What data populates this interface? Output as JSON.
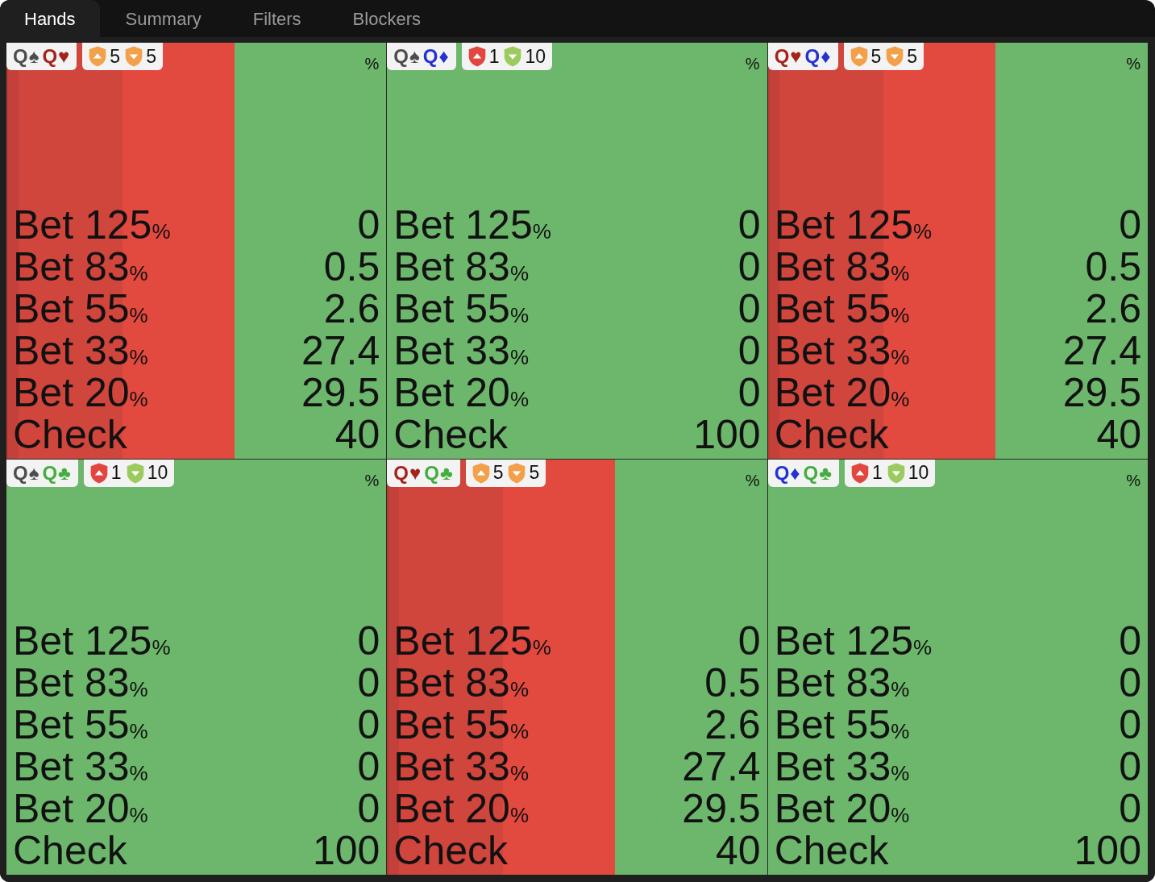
{
  "tabs": [
    {
      "label": "Hands",
      "selected": true
    },
    {
      "label": "Summary",
      "selected": false
    },
    {
      "label": "Filters",
      "selected": false
    },
    {
      "label": "Blockers",
      "selected": false
    }
  ],
  "cells": [
    {
      "hand": [
        {
          "label": "Q♠",
          "color": "#4d4d4d"
        },
        {
          "label": "Q♥",
          "color": "#a3241b"
        }
      ],
      "blockers": [
        {
          "kind": "up",
          "count": "5",
          "color": "#f2a04a"
        },
        {
          "kind": "down",
          "count": "5",
          "color": "#f2a04a"
        }
      ],
      "unit": "%",
      "actions": [
        {
          "label": "Bet 125",
          "unit": "%",
          "value": "0"
        },
        {
          "label": "Bet 83",
          "unit": "%",
          "value": "0.5",
          "color": "#b83b34"
        },
        {
          "label": "Bet 55",
          "unit": "%",
          "value": "2.6",
          "color": "#c4403a"
        },
        {
          "label": "Bet 33",
          "unit": "%",
          "value": "27.4",
          "color": "#d0453c"
        },
        {
          "label": "Bet 20",
          "unit": "%",
          "value": "29.5",
          "color": "#e2493f"
        },
        {
          "label": "Check",
          "value": "40",
          "color": "#6cb76b"
        }
      ]
    },
    {
      "hand": [
        {
          "label": "Q♠",
          "color": "#4d4d4d"
        },
        {
          "label": "Q♦",
          "color": "#2632d0"
        }
      ],
      "blockers": [
        {
          "kind": "up",
          "count": "1",
          "color": "#e2463f"
        },
        {
          "kind": "down",
          "count": "10",
          "color": "#9bcb5e"
        }
      ],
      "unit": "%",
      "actions": [
        {
          "label": "Bet 125",
          "unit": "%",
          "value": "0"
        },
        {
          "label": "Bet 83",
          "unit": "%",
          "value": "0"
        },
        {
          "label": "Bet 55",
          "unit": "%",
          "value": "0"
        },
        {
          "label": "Bet 33",
          "unit": "%",
          "value": "0"
        },
        {
          "label": "Bet 20",
          "unit": "%",
          "value": "0"
        },
        {
          "label": "Check",
          "value": "100",
          "color": "#6cb76b"
        }
      ]
    },
    {
      "hand": [
        {
          "label": "Q♥",
          "color": "#a3241b"
        },
        {
          "label": "Q♦",
          "color": "#2632d0"
        }
      ],
      "blockers": [
        {
          "kind": "up",
          "count": "5",
          "color": "#f2a04a"
        },
        {
          "kind": "down",
          "count": "5",
          "color": "#f2a04a"
        }
      ],
      "unit": "%",
      "actions": [
        {
          "label": "Bet 125",
          "unit": "%",
          "value": "0"
        },
        {
          "label": "Bet 83",
          "unit": "%",
          "value": "0.5",
          "color": "#b83b34"
        },
        {
          "label": "Bet 55",
          "unit": "%",
          "value": "2.6",
          "color": "#c4403a"
        },
        {
          "label": "Bet 33",
          "unit": "%",
          "value": "27.4",
          "color": "#d0453c"
        },
        {
          "label": "Bet 20",
          "unit": "%",
          "value": "29.5",
          "color": "#e2493f"
        },
        {
          "label": "Check",
          "value": "40",
          "color": "#6cb76b"
        }
      ]
    },
    {
      "hand": [
        {
          "label": "Q♠",
          "color": "#4d4d4d"
        },
        {
          "label": "Q♣",
          "color": "#43ad3f"
        }
      ],
      "blockers": [
        {
          "kind": "up",
          "count": "1",
          "color": "#e2463f"
        },
        {
          "kind": "down",
          "count": "10",
          "color": "#9bcb5e"
        }
      ],
      "unit": "%",
      "actions": [
        {
          "label": "Bet 125",
          "unit": "%",
          "value": "0"
        },
        {
          "label": "Bet 83",
          "unit": "%",
          "value": "0"
        },
        {
          "label": "Bet 55",
          "unit": "%",
          "value": "0"
        },
        {
          "label": "Bet 33",
          "unit": "%",
          "value": "0"
        },
        {
          "label": "Bet 20",
          "unit": "%",
          "value": "0"
        },
        {
          "label": "Check",
          "value": "100",
          "color": "#6cb76b"
        }
      ]
    },
    {
      "hand": [
        {
          "label": "Q♥",
          "color": "#a3241b"
        },
        {
          "label": "Q♣",
          "color": "#43ad3f"
        }
      ],
      "blockers": [
        {
          "kind": "up",
          "count": "5",
          "color": "#f2a04a"
        },
        {
          "kind": "down",
          "count": "5",
          "color": "#f2a04a"
        }
      ],
      "unit": "%",
      "actions": [
        {
          "label": "Bet 125",
          "unit": "%",
          "value": "0"
        },
        {
          "label": "Bet 83",
          "unit": "%",
          "value": "0.5",
          "color": "#b83b34"
        },
        {
          "label": "Bet 55",
          "unit": "%",
          "value": "2.6",
          "color": "#c4403a"
        },
        {
          "label": "Bet 33",
          "unit": "%",
          "value": "27.4",
          "color": "#d0453c"
        },
        {
          "label": "Bet 20",
          "unit": "%",
          "value": "29.5",
          "color": "#e2493f"
        },
        {
          "label": "Check",
          "value": "40",
          "color": "#6cb76b"
        }
      ]
    },
    {
      "hand": [
        {
          "label": "Q♦",
          "color": "#2632d0"
        },
        {
          "label": "Q♣",
          "color": "#43ad3f"
        }
      ],
      "blockers": [
        {
          "kind": "up",
          "count": "1",
          "color": "#e2463f"
        },
        {
          "kind": "down",
          "count": "10",
          "color": "#9bcb5e"
        }
      ],
      "unit": "%",
      "actions": [
        {
          "label": "Bet 125",
          "unit": "%",
          "value": "0"
        },
        {
          "label": "Bet 83",
          "unit": "%",
          "value": "0"
        },
        {
          "label": "Bet 55",
          "unit": "%",
          "value": "0"
        },
        {
          "label": "Bet 33",
          "unit": "%",
          "value": "0"
        },
        {
          "label": "Bet 20",
          "unit": "%",
          "value": "0"
        },
        {
          "label": "Check",
          "value": "100",
          "color": "#6cb76b"
        }
      ]
    }
  ]
}
